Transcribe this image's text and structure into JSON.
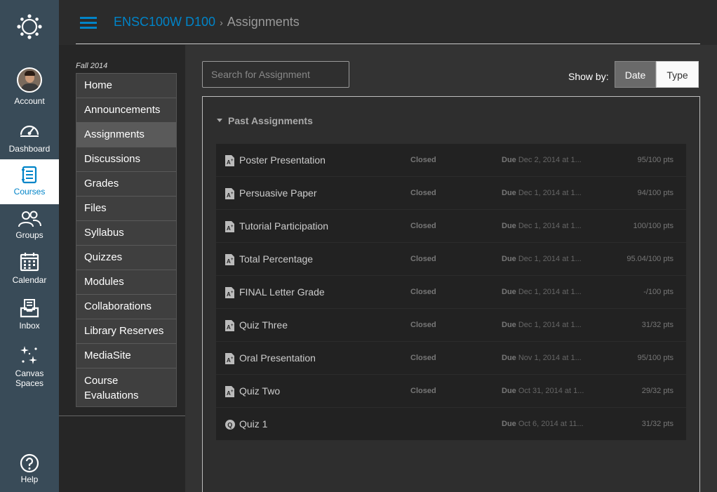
{
  "global_nav": {
    "items": [
      {
        "label": "Account",
        "icon": "avatar"
      },
      {
        "label": "Dashboard",
        "icon": "dashboard-icon"
      },
      {
        "label": "Courses",
        "icon": "courses-icon",
        "active": true
      },
      {
        "label": "Groups",
        "icon": "groups-icon"
      },
      {
        "label": "Calendar",
        "icon": "calendar-icon"
      },
      {
        "label": "Inbox",
        "icon": "inbox-icon"
      },
      {
        "label": "Canvas Spaces",
        "icon": "sparkle-icon"
      },
      {
        "label": "Help",
        "icon": "help-icon"
      }
    ],
    "colors": {
      "bg": "#394b58",
      "active_text": "#0084c8"
    }
  },
  "header": {
    "course": "ENSC100W D100",
    "separator": "›",
    "page": "Assignments"
  },
  "course_nav": {
    "term": "Fall 2014",
    "items": [
      "Home",
      "Announcements",
      "Assignments",
      "Discussions",
      "Grades",
      "Files",
      "Syllabus",
      "Quizzes",
      "Modules",
      "Collaborations",
      "Library Reserves",
      "MediaSite",
      "Course Evaluations"
    ],
    "active": "Assignments"
  },
  "toolbar": {
    "search_placeholder": "Search for Assignment",
    "show_by_label": "Show by:",
    "toggle": {
      "date": "Date",
      "type": "Type",
      "selected": "Date"
    }
  },
  "group": {
    "title": "Past Assignments",
    "due_prefix": "Due",
    "assignments": [
      {
        "name": "Poster Presentation",
        "status": "Closed",
        "due": "Dec 2, 2014 at 1...",
        "points": "95/100 pts",
        "icon": "assignment-icon"
      },
      {
        "name": "Persuasive Paper",
        "status": "Closed",
        "due": "Dec 1, 2014 at 1...",
        "points": "94/100 pts",
        "icon": "assignment-icon"
      },
      {
        "name": "Tutorial Participation",
        "status": "Closed",
        "due": "Dec 1, 2014 at 1...",
        "points": "100/100 pts",
        "icon": "assignment-icon"
      },
      {
        "name": "Total Percentage",
        "status": "Closed",
        "due": "Dec 1, 2014 at 1...",
        "points": "95.04/100 pts",
        "icon": "assignment-icon"
      },
      {
        "name": "FINAL Letter Grade",
        "status": "Closed",
        "due": "Dec 1, 2014 at 1...",
        "points": "-/100 pts",
        "icon": "assignment-icon"
      },
      {
        "name": "Quiz Three",
        "status": "Closed",
        "due": "Dec 1, 2014 at 1...",
        "points": "31/32 pts",
        "icon": "assignment-icon"
      },
      {
        "name": "Oral Presentation",
        "status": "Closed",
        "due": "Nov 1, 2014 at 1...",
        "points": "95/100 pts",
        "icon": "assignment-icon"
      },
      {
        "name": "Quiz Two",
        "status": "Closed",
        "due": "Oct 31, 2014 at 1...",
        "points": "29/32 pts",
        "icon": "assignment-icon"
      },
      {
        "name": "Quiz 1",
        "status": "",
        "due": "Oct 6, 2014 at 11...",
        "points": "31/32 pts",
        "icon": "quiz-icon"
      }
    ]
  }
}
